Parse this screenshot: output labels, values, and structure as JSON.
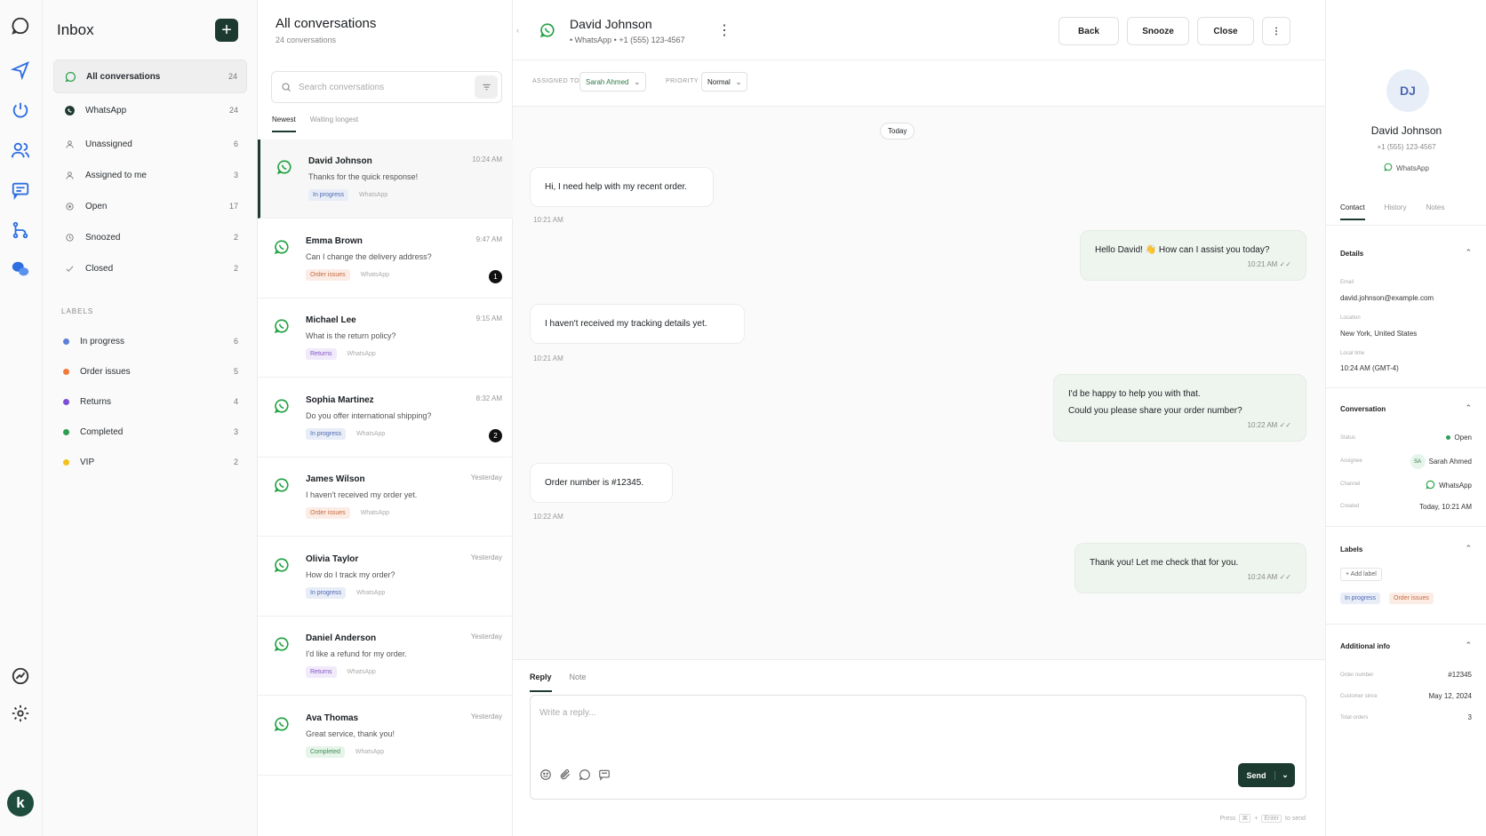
{
  "sidebar": {
    "title": "Inbox",
    "items": [
      {
        "label": "All conversations",
        "count": "24"
      },
      {
        "label": "WhatsApp",
        "count": "24"
      },
      {
        "label": "Unassigned",
        "count": "6"
      },
      {
        "label": "Assigned to me",
        "count": "3"
      },
      {
        "label": "Open",
        "count": "17"
      },
      {
        "label": "Snoozed",
        "count": "2"
      },
      {
        "label": "Closed",
        "count": "2"
      }
    ],
    "labels_heading": "LABELS",
    "labels": [
      {
        "label": "In progress",
        "count": "6",
        "color": "#5b7fd6"
      },
      {
        "label": "Order issues",
        "count": "5",
        "color": "#f07a3a"
      },
      {
        "label": "Returns",
        "count": "4",
        "color": "#7b4fd8"
      },
      {
        "label": "Completed",
        "count": "3",
        "color": "#2f9e55"
      },
      {
        "label": "VIP",
        "count": "2",
        "color": "#f2c21b"
      }
    ],
    "user_initial": "k"
  },
  "list": {
    "title": "All conversations",
    "subtitle": "24 conversations",
    "search_placeholder": "Search conversations",
    "sort_tabs": [
      "Newest",
      "Waiting longest"
    ],
    "conversations": [
      {
        "name": "David Johnson",
        "time": "10:24 AM",
        "preview": "Thanks for the quick response!",
        "tag": "In progress",
        "channel": "WhatsApp",
        "badge": ""
      },
      {
        "name": "Emma Brown",
        "time": "9:47 AM",
        "preview": "Can I change the delivery address?",
        "tag": "Order issues",
        "channel": "WhatsApp",
        "badge": "1"
      },
      {
        "name": "Michael Lee",
        "time": "9:15 AM",
        "preview": "What is the return policy?",
        "tag": "Returns",
        "channel": "WhatsApp",
        "badge": ""
      },
      {
        "name": "Sophia Martinez",
        "time": "8:32 AM",
        "preview": "Do you offer international shipping?",
        "tag": "In progress",
        "channel": "WhatsApp",
        "badge": "2"
      },
      {
        "name": "James Wilson",
        "time": "Yesterday",
        "preview": "I haven't received my order yet.",
        "tag": "Order issues",
        "channel": "WhatsApp",
        "badge": ""
      },
      {
        "name": "Olivia Taylor",
        "time": "Yesterday",
        "preview": "How do I track my order?",
        "tag": "In progress",
        "channel": "WhatsApp",
        "badge": ""
      },
      {
        "name": "Daniel Anderson",
        "time": "Yesterday",
        "preview": "I'd like a refund for my order.",
        "tag": "Returns",
        "channel": "WhatsApp",
        "badge": ""
      },
      {
        "name": "Ava Thomas",
        "time": "Yesterday",
        "preview": "Great service, thank you!",
        "tag": "Completed",
        "channel": "WhatsApp",
        "badge": ""
      }
    ]
  },
  "chat": {
    "name": "David Johnson",
    "meta": "• WhatsApp • +1 (555) 123-4567",
    "buttons": {
      "back": "Back",
      "snooze": "Snooze",
      "close": "Close"
    },
    "assigned_label": "ASSIGNED TO",
    "assigned_value": "Sarah Ahmed",
    "priority_label": "PRIORITY",
    "priority_value": "Normal",
    "day": "Today",
    "messages": [
      {
        "dir": "in",
        "text": "Hi, I need help with my recent order.",
        "time": "10:21 AM"
      },
      {
        "dir": "out",
        "text": "Hello David! 👋 How can I assist you today?",
        "time": "10:21 AM"
      },
      {
        "dir": "in",
        "text": "I haven't received my tracking details yet.",
        "time": "10:21 AM"
      },
      {
        "dir": "out",
        "text": "I'd be happy to help you with that.",
        "text2": "Could you please share your order number?",
        "time": "10:22 AM"
      },
      {
        "dir": "in",
        "text": "Order number is #12345.",
        "time": "10:22 AM"
      },
      {
        "dir": "out",
        "text": "Thank you!  Let me check that for you.",
        "time": "10:24 AM"
      }
    ],
    "composer": {
      "tabs": [
        "Reply",
        "Note"
      ],
      "placeholder": "Write a reply...",
      "send": "Send",
      "hint_press": "Press",
      "hint_cmd": "⌘",
      "hint_plus": "+",
      "hint_enter": "Enter",
      "hint_tail": "to send"
    }
  },
  "contact": {
    "initials": "DJ",
    "name": "David Johnson",
    "phone": "+1 (555) 123-4567",
    "channel": "WhatsApp",
    "tabs": [
      "Contact",
      "History",
      "Notes"
    ],
    "details": {
      "heading": "Details",
      "email_label": "Email",
      "email": "david.johnson@example.com",
      "location_label": "Location",
      "location": "New York, United States",
      "time_label": "Local time",
      "time": "10:24 AM (GMT-4)"
    },
    "conversation": {
      "heading": "Conversation",
      "status_label": "Status",
      "status": "Open",
      "assignee_label": "Assignee",
      "assignee_initials": "SA",
      "assignee": "Sarah Ahmed",
      "channel_label": "Channel",
      "channel": "WhatsApp",
      "created_label": "Created",
      "created": "Today, 10:21 AM"
    },
    "labels": {
      "heading": "Labels",
      "add": "Add label",
      "items": [
        "In progress",
        "Order issues"
      ]
    },
    "additional": {
      "heading": "Additional info",
      "order_label": "Order number",
      "order": "#12345",
      "since_label": "Customer since",
      "since": "May 12, 2024",
      "total_label": "Total orders",
      "total": "3"
    }
  }
}
